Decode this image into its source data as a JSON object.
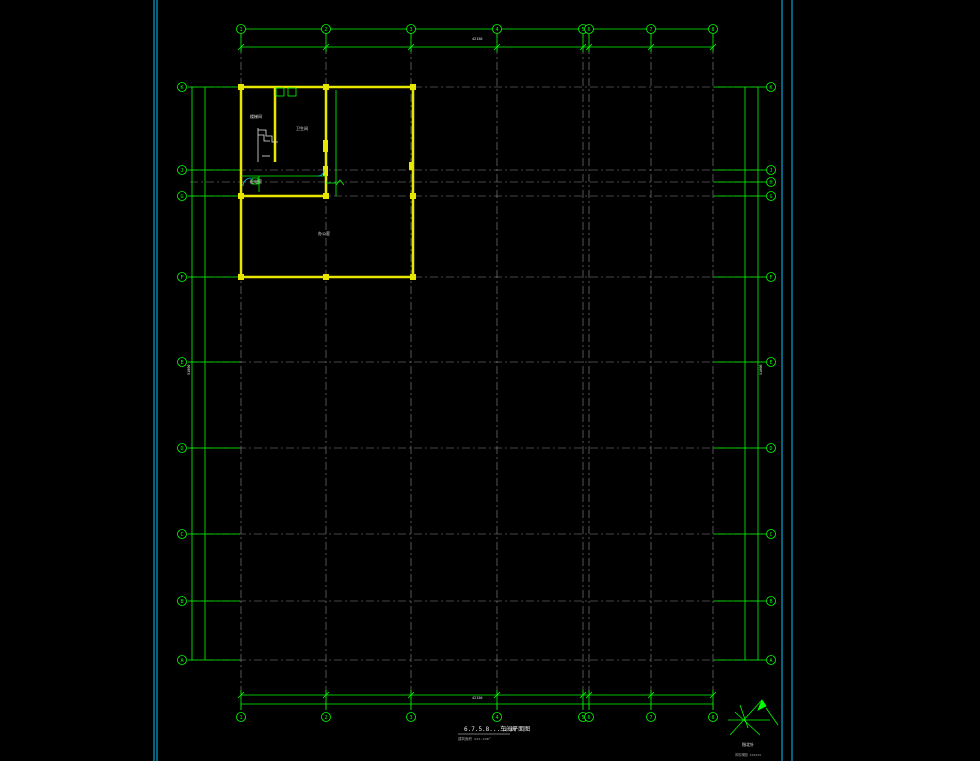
{
  "canvas": {
    "background": "#000000",
    "colors": {
      "grid": "#00ff00",
      "wall": "#e6e600",
      "frame": "#00c8ff",
      "text": "#e8e8e8",
      "axis_dash": "#c8c8c8",
      "blue": "#3a6cff"
    }
  },
  "axes": {
    "top_columns": [
      "1",
      "2",
      "3",
      "4",
      "5",
      "6",
      "7",
      "8"
    ],
    "bottom_columns": [
      "1",
      "2",
      "3",
      "4",
      "5",
      "6",
      "7",
      "8"
    ],
    "left_rows": [
      "K",
      "J",
      "G",
      "F",
      "E",
      "D",
      "C",
      "B",
      "A"
    ],
    "right_rows": [
      "K",
      "J",
      "H",
      "G",
      "F",
      "E",
      "D",
      "C",
      "B",
      "A"
    ]
  },
  "dimensions": {
    "top_total": "42150",
    "bottom_total": "42150",
    "left_total": "51000",
    "right_total": "51000"
  },
  "drawing": {
    "title": "6.7.5.8...车间平面图",
    "scale": "1:100",
    "subtitle": "建筑面积 xxx.xxm²",
    "room_labels": [
      "楼梯间",
      "卫生间",
      "配电室",
      "办公室"
    ],
    "legend_title": "指北针",
    "legend_text": "风玫瑰图 xxxxxx"
  }
}
